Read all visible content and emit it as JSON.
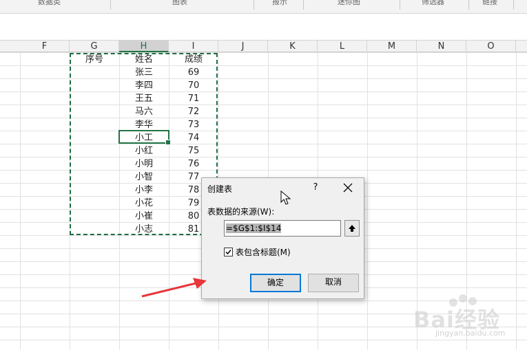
{
  "ribbon": {
    "groups": [
      "数据类",
      "图表",
      "报示",
      "迷你图",
      "筛选器",
      "链接"
    ]
  },
  "columns": [
    "F",
    "G",
    "H",
    "I",
    "J",
    "K",
    "L",
    "M",
    "N",
    "O"
  ],
  "table": {
    "headers": [
      "序号",
      "姓名",
      "成绩"
    ],
    "rows": [
      {
        "name": "张三",
        "score": "69"
      },
      {
        "name": "李四",
        "score": "70"
      },
      {
        "name": "王五",
        "score": "71"
      },
      {
        "name": "马六",
        "score": "72"
      },
      {
        "name": "李华",
        "score": "73"
      },
      {
        "name": "小工",
        "score": "74"
      },
      {
        "name": "小红",
        "score": "75"
      },
      {
        "name": "小明",
        "score": "76"
      },
      {
        "name": "小智",
        "score": "77"
      },
      {
        "name": "小李",
        "score": "78"
      },
      {
        "name": "小花",
        "score": "79"
      },
      {
        "name": "小崔",
        "score": "80"
      },
      {
        "name": "小志",
        "score": "81"
      }
    ]
  },
  "dialog": {
    "title": "创建表",
    "help": "?",
    "source_label": "表数据的来源(W):",
    "range_value": "=$G$1:$I$14",
    "has_headers_label": "表包含标题(M)",
    "has_headers_checked": true,
    "ok_label": "确定",
    "cancel_label": "取消"
  },
  "watermark": {
    "text": "Bai经验",
    "sub": "jingyan.baidu.com"
  },
  "colors": {
    "excel_green": "#217346",
    "marquee": "#1e6b41",
    "ok_border": "#0078d7",
    "annotation_red": "#e8363a"
  }
}
